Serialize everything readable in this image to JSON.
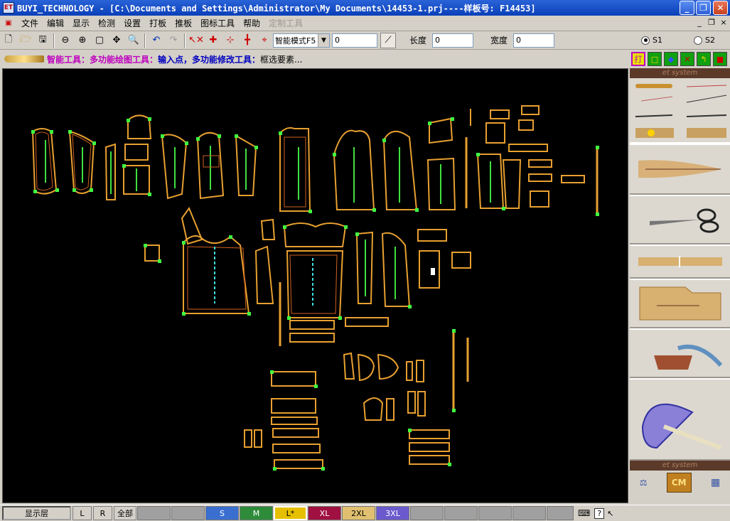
{
  "window": {
    "title": "BUYI_TECHNOLOGY - [C:\\Documents and Settings\\Administrator\\My Documents\\14453-1.prj----样板号: F14453]",
    "app_icon_label": "ET",
    "min_glyph": "_",
    "max_glyph": "❐",
    "close_glyph": "✕"
  },
  "menu": {
    "items": [
      "文件",
      "编辑",
      "显示",
      "检测",
      "设置",
      "打板",
      "推板",
      "图标工具",
      "帮助",
      "定制工具"
    ],
    "mdi_min": "_",
    "mdi_restore": "❐",
    "mdi_close": "×"
  },
  "toolbar": {
    "mode_value": "智能模式F5",
    "field1_value": "0",
    "length_label": "长度",
    "length_value": "0",
    "width_label": "宽度",
    "width_value": "0",
    "radio_s1": "S1",
    "radio_s2": "S2",
    "selected_radio": "S1"
  },
  "status": {
    "smart_tool": "智能工具：多功能绘图工具：",
    "input_point": "输入点，多功能修改工具：",
    "box_select": "框选要素..."
  },
  "right_panel": {
    "banner_top": "et system",
    "banner_bottom": "et system",
    "top_buttons": [
      "打",
      "□",
      "◆",
      "✕",
      "↰",
      "■"
    ],
    "cm_label": "CM"
  },
  "bottom": {
    "layer_label": "显示层",
    "l_label": "L",
    "r_label": "R",
    "all_label": "全部",
    "sizes": [
      {
        "label": "S",
        "color": "#3a6fd0"
      },
      {
        "label": "M",
        "color": "#2e8b3a"
      },
      {
        "label": "L*",
        "color": "#e6c000"
      },
      {
        "label": "XL",
        "color": "#a01040"
      },
      {
        "label": "2XL",
        "color": "#e0c070"
      },
      {
        "label": "3XL",
        "color": "#6a5acd"
      }
    ]
  },
  "colors": {
    "piece_outline": "#e8a030",
    "piece_inner": "#d06020",
    "grain_line": "#40e040",
    "point_marker": "#40ff40",
    "canvas_bg": "#000000"
  }
}
